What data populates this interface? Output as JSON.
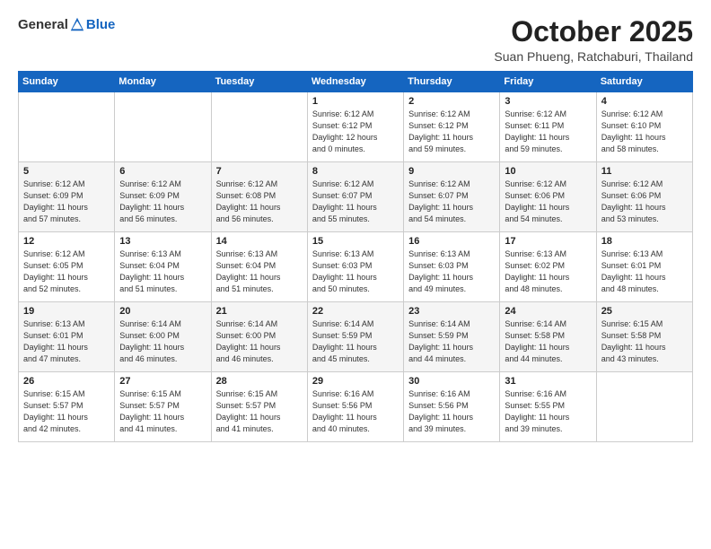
{
  "logo": {
    "general": "General",
    "blue": "Blue"
  },
  "header": {
    "title": "October 2025",
    "subtitle": "Suan Phueng, Ratchaburi, Thailand"
  },
  "weekdays": [
    "Sunday",
    "Monday",
    "Tuesday",
    "Wednesday",
    "Thursday",
    "Friday",
    "Saturday"
  ],
  "weeks": [
    [
      {
        "day": "",
        "info": ""
      },
      {
        "day": "",
        "info": ""
      },
      {
        "day": "",
        "info": ""
      },
      {
        "day": "1",
        "info": "Sunrise: 6:12 AM\nSunset: 6:12 PM\nDaylight: 12 hours\nand 0 minutes."
      },
      {
        "day": "2",
        "info": "Sunrise: 6:12 AM\nSunset: 6:12 PM\nDaylight: 11 hours\nand 59 minutes."
      },
      {
        "day": "3",
        "info": "Sunrise: 6:12 AM\nSunset: 6:11 PM\nDaylight: 11 hours\nand 59 minutes."
      },
      {
        "day": "4",
        "info": "Sunrise: 6:12 AM\nSunset: 6:10 PM\nDaylight: 11 hours\nand 58 minutes."
      }
    ],
    [
      {
        "day": "5",
        "info": "Sunrise: 6:12 AM\nSunset: 6:09 PM\nDaylight: 11 hours\nand 57 minutes."
      },
      {
        "day": "6",
        "info": "Sunrise: 6:12 AM\nSunset: 6:09 PM\nDaylight: 11 hours\nand 56 minutes."
      },
      {
        "day": "7",
        "info": "Sunrise: 6:12 AM\nSunset: 6:08 PM\nDaylight: 11 hours\nand 56 minutes."
      },
      {
        "day": "8",
        "info": "Sunrise: 6:12 AM\nSunset: 6:07 PM\nDaylight: 11 hours\nand 55 minutes."
      },
      {
        "day": "9",
        "info": "Sunrise: 6:12 AM\nSunset: 6:07 PM\nDaylight: 11 hours\nand 54 minutes."
      },
      {
        "day": "10",
        "info": "Sunrise: 6:12 AM\nSunset: 6:06 PM\nDaylight: 11 hours\nand 54 minutes."
      },
      {
        "day": "11",
        "info": "Sunrise: 6:12 AM\nSunset: 6:06 PM\nDaylight: 11 hours\nand 53 minutes."
      }
    ],
    [
      {
        "day": "12",
        "info": "Sunrise: 6:12 AM\nSunset: 6:05 PM\nDaylight: 11 hours\nand 52 minutes."
      },
      {
        "day": "13",
        "info": "Sunrise: 6:13 AM\nSunset: 6:04 PM\nDaylight: 11 hours\nand 51 minutes."
      },
      {
        "day": "14",
        "info": "Sunrise: 6:13 AM\nSunset: 6:04 PM\nDaylight: 11 hours\nand 51 minutes."
      },
      {
        "day": "15",
        "info": "Sunrise: 6:13 AM\nSunset: 6:03 PM\nDaylight: 11 hours\nand 50 minutes."
      },
      {
        "day": "16",
        "info": "Sunrise: 6:13 AM\nSunset: 6:03 PM\nDaylight: 11 hours\nand 49 minutes."
      },
      {
        "day": "17",
        "info": "Sunrise: 6:13 AM\nSunset: 6:02 PM\nDaylight: 11 hours\nand 48 minutes."
      },
      {
        "day": "18",
        "info": "Sunrise: 6:13 AM\nSunset: 6:01 PM\nDaylight: 11 hours\nand 48 minutes."
      }
    ],
    [
      {
        "day": "19",
        "info": "Sunrise: 6:13 AM\nSunset: 6:01 PM\nDaylight: 11 hours\nand 47 minutes."
      },
      {
        "day": "20",
        "info": "Sunrise: 6:14 AM\nSunset: 6:00 PM\nDaylight: 11 hours\nand 46 minutes."
      },
      {
        "day": "21",
        "info": "Sunrise: 6:14 AM\nSunset: 6:00 PM\nDaylight: 11 hours\nand 46 minutes."
      },
      {
        "day": "22",
        "info": "Sunrise: 6:14 AM\nSunset: 5:59 PM\nDaylight: 11 hours\nand 45 minutes."
      },
      {
        "day": "23",
        "info": "Sunrise: 6:14 AM\nSunset: 5:59 PM\nDaylight: 11 hours\nand 44 minutes."
      },
      {
        "day": "24",
        "info": "Sunrise: 6:14 AM\nSunset: 5:58 PM\nDaylight: 11 hours\nand 44 minutes."
      },
      {
        "day": "25",
        "info": "Sunrise: 6:15 AM\nSunset: 5:58 PM\nDaylight: 11 hours\nand 43 minutes."
      }
    ],
    [
      {
        "day": "26",
        "info": "Sunrise: 6:15 AM\nSunset: 5:57 PM\nDaylight: 11 hours\nand 42 minutes."
      },
      {
        "day": "27",
        "info": "Sunrise: 6:15 AM\nSunset: 5:57 PM\nDaylight: 11 hours\nand 41 minutes."
      },
      {
        "day": "28",
        "info": "Sunrise: 6:15 AM\nSunset: 5:57 PM\nDaylight: 11 hours\nand 41 minutes."
      },
      {
        "day": "29",
        "info": "Sunrise: 6:16 AM\nSunset: 5:56 PM\nDaylight: 11 hours\nand 40 minutes."
      },
      {
        "day": "30",
        "info": "Sunrise: 6:16 AM\nSunset: 5:56 PM\nDaylight: 11 hours\nand 39 minutes."
      },
      {
        "day": "31",
        "info": "Sunrise: 6:16 AM\nSunset: 5:55 PM\nDaylight: 11 hours\nand 39 minutes."
      },
      {
        "day": "",
        "info": ""
      }
    ]
  ]
}
